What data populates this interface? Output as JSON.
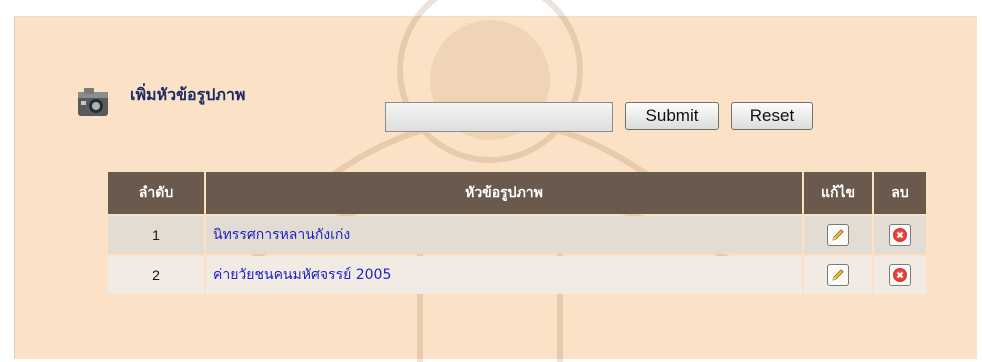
{
  "page_title": "เพิ่มหัวข้อรูปภาพ",
  "form": {
    "topic_input_value": "",
    "submit_label": "Submit",
    "reset_label": "Reset"
  },
  "table": {
    "headers": [
      "ลำดับ",
      "หัวข้อรูปภาพ",
      "แก้ไข",
      "ลบ"
    ],
    "rows": [
      {
        "num": "1",
        "title": "นิทรรศการหลานกังเก่ง"
      },
      {
        "num": "2",
        "title": "ค่ายวัยชนคนมหัศจรรย์ 2005"
      }
    ]
  },
  "icons": {
    "header": "camera-icon",
    "edit": "pencil-edit-icon",
    "delete": "red-delete-icon"
  },
  "colors": {
    "panel_bg": "#fbe2c6",
    "header_bg": "#6a5a4d",
    "link": "#1b1fc9",
    "title": "#1c2a63"
  }
}
